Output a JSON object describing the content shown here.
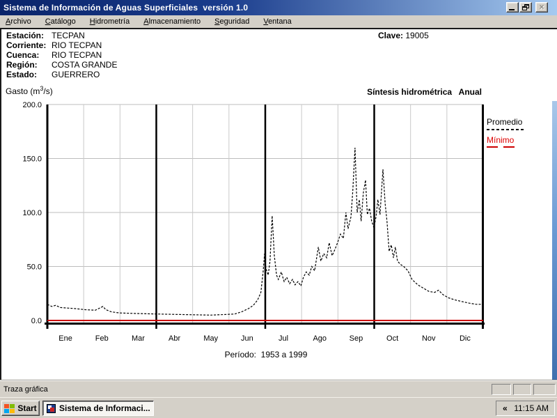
{
  "window": {
    "title": "Sistema de Información de Aguas Superficiales  versión 1.0"
  },
  "menu": {
    "items": [
      {
        "accel": "A",
        "rest": "rchivo"
      },
      {
        "accel": "C",
        "rest": "atálogo"
      },
      {
        "accel": "H",
        "rest": "idrometría"
      },
      {
        "accel": "A",
        "rest": "lmacenamiento"
      },
      {
        "accel": "S",
        "rest": "eguridad"
      },
      {
        "accel": "V",
        "rest": "entana"
      }
    ]
  },
  "station": {
    "rows": [
      {
        "label": "Estación:",
        "value": "TECPAN"
      },
      {
        "label": "Corriente:",
        "value": "RIO TECPAN"
      },
      {
        "label": "Cuenca:",
        "value": "RIO TECPAN"
      },
      {
        "label": "Región:",
        "value": "COSTA GRANDE"
      },
      {
        "label": "Estado:",
        "value": "GUERRERO"
      }
    ],
    "clave_label": "Clave:",
    "clave_value": "19005"
  },
  "chart_data": {
    "type": "line",
    "title": "Síntesis hidrométrica   Anual",
    "ylabel": "Gasto (m³/s)",
    "ylabel_parts": [
      "Gasto (m",
      "3",
      "/s)"
    ],
    "caption": "Período:  1953 a 1999",
    "ylim": [
      0,
      200
    ],
    "grid": true,
    "yticks": [
      {
        "label": "200.0",
        "value": 200
      },
      {
        "label": "150.0",
        "value": 150
      },
      {
        "label": "100.0",
        "value": 100
      },
      {
        "label": "50.0",
        "value": 50
      },
      {
        "label": "0.0",
        "value": 0
      }
    ],
    "months": [
      "Ene",
      "Feb",
      "Mar",
      "Abr",
      "May",
      "Jun",
      "Jul",
      "Ago",
      "Sep",
      "Oct",
      "Nov",
      "Dic"
    ],
    "legend": [
      {
        "label": "Promedio",
        "color": "#000000",
        "dash": "short"
      },
      {
        "label": "Mínimo",
        "color": "#cc0000",
        "dash": "long"
      }
    ],
    "series": [
      {
        "name": "Promedio",
        "color": "#000000",
        "style": "dashed",
        "points": [
          [
            0,
            15
          ],
          [
            0.12,
            13
          ],
          [
            0.23,
            14
          ],
          [
            0.36,
            12
          ],
          [
            0.56,
            11.5
          ],
          [
            0.75,
            11
          ],
          [
            1.04,
            10
          ],
          [
            1.32,
            9.5
          ],
          [
            1.53,
            13
          ],
          [
            1.61,
            10
          ],
          [
            1.76,
            8
          ],
          [
            1.99,
            7
          ],
          [
            2.38,
            6.5
          ],
          [
            2.99,
            6
          ],
          [
            3.72,
            5.5
          ],
          [
            4.49,
            5
          ],
          [
            4.87,
            5.5
          ],
          [
            5.16,
            6
          ],
          [
            5.35,
            8
          ],
          [
            5.54,
            11
          ],
          [
            5.67,
            14
          ],
          [
            5.79,
            19
          ],
          [
            5.88,
            26
          ],
          [
            5.94,
            45
          ],
          [
            5.98,
            62
          ],
          [
            6.02,
            48
          ],
          [
            6.08,
            42
          ],
          [
            6.13,
            55
          ],
          [
            6.19,
            97
          ],
          [
            6.25,
            60
          ],
          [
            6.31,
            42
          ],
          [
            6.36,
            38
          ],
          [
            6.44,
            45
          ],
          [
            6.52,
            36
          ],
          [
            6.59,
            40
          ],
          [
            6.67,
            34
          ],
          [
            6.75,
            38
          ],
          [
            6.82,
            33
          ],
          [
            6.9,
            36
          ],
          [
            6.98,
            32
          ],
          [
            7.05,
            40
          ],
          [
            7.13,
            45
          ],
          [
            7.21,
            42
          ],
          [
            7.28,
            50
          ],
          [
            7.36,
            46
          ],
          [
            7.46,
            68
          ],
          [
            7.53,
            55
          ],
          [
            7.61,
            62
          ],
          [
            7.69,
            58
          ],
          [
            7.76,
            72
          ],
          [
            7.84,
            60
          ],
          [
            7.92,
            66
          ],
          [
            7.99,
            72
          ],
          [
            8.07,
            80
          ],
          [
            8.15,
            76
          ],
          [
            8.22,
            100
          ],
          [
            8.28,
            85
          ],
          [
            8.36,
            96
          ],
          [
            8.41,
            120
          ],
          [
            8.47,
            160
          ],
          [
            8.53,
            100
          ],
          [
            8.59,
            112
          ],
          [
            8.64,
            92
          ],
          [
            8.7,
            118
          ],
          [
            8.76,
            130
          ],
          [
            8.81,
            98
          ],
          [
            8.87,
            104
          ],
          [
            8.93,
            92
          ],
          [
            8.99,
            86
          ],
          [
            9.05,
            96
          ],
          [
            9.1,
            112
          ],
          [
            9.16,
            98
          ],
          [
            9.24,
            140
          ],
          [
            9.3,
            108
          ],
          [
            9.35,
            92
          ],
          [
            9.41,
            64
          ],
          [
            9.47,
            70
          ],
          [
            9.53,
            58
          ],
          [
            9.58,
            68
          ],
          [
            9.64,
            55
          ],
          [
            9.72,
            52
          ],
          [
            9.81,
            50
          ],
          [
            9.93,
            46
          ],
          [
            10.04,
            38
          ],
          [
            10.2,
            33
          ],
          [
            10.35,
            30
          ],
          [
            10.5,
            27
          ],
          [
            10.66,
            26
          ],
          [
            10.77,
            28
          ],
          [
            10.89,
            24
          ],
          [
            11.04,
            21
          ],
          [
            11.23,
            19
          ],
          [
            11.42,
            17.5
          ],
          [
            11.62,
            16
          ],
          [
            11.81,
            15
          ],
          [
            12,
            15
          ]
        ]
      },
      {
        "name": "Mínimo",
        "color": "#cc0000",
        "style": "solid",
        "points": [
          [
            0,
            0
          ],
          [
            12,
            0
          ]
        ]
      }
    ]
  },
  "status": {
    "text": "Traza gráfica"
  },
  "taskbar": {
    "start_label": "Start",
    "task_label": "Sistema de Informaci...",
    "tray_chevron": "«",
    "clock": "11:15 AM"
  }
}
